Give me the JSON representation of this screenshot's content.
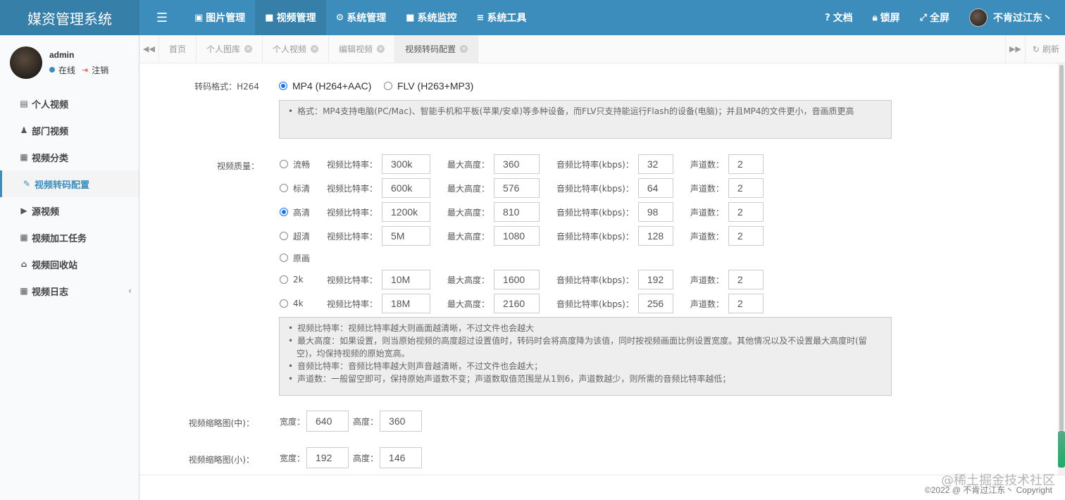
{
  "app": {
    "title": "媒资管理系统"
  },
  "topnav": {
    "items": [
      {
        "label": "图片管理",
        "icon": "image-icon"
      },
      {
        "label": "视频管理",
        "icon": "video-icon",
        "active": true
      },
      {
        "label": "系统管理",
        "icon": "gear-icon"
      },
      {
        "label": "系统监控",
        "icon": "monitor-icon"
      },
      {
        "label": "系统工具",
        "icon": "bars-icon"
      }
    ],
    "right": {
      "docs": "文档",
      "lock": "锁屏",
      "fullscreen": "全屏",
      "user": "不肯过江东丶"
    }
  },
  "sidebar": {
    "user": {
      "name": "admin",
      "status": "在线",
      "logout": "注销"
    },
    "items": [
      {
        "label": "个人视频",
        "icon": "file-icon"
      },
      {
        "label": "部门视频",
        "icon": "users-icon"
      },
      {
        "label": "视频分类",
        "icon": "calendar-icon"
      },
      {
        "label": "视频转码配置",
        "icon": "wrench-icon",
        "active": true
      },
      {
        "label": "源视频",
        "icon": "play-square-icon"
      },
      {
        "label": "视频加工任务",
        "icon": "calendar-icon"
      },
      {
        "label": "视频回收站",
        "icon": "basket-icon"
      },
      {
        "label": "视频日志",
        "icon": "calendar-icon"
      }
    ]
  },
  "tabs": {
    "items": [
      {
        "label": "首页",
        "closable": false
      },
      {
        "label": "个人图库",
        "closable": true
      },
      {
        "label": "个人视频",
        "closable": true
      },
      {
        "label": "编辑视频",
        "closable": true
      },
      {
        "label": "视频转码配置",
        "closable": true,
        "active": true
      }
    ],
    "refresh": "刷新"
  },
  "form": {
    "format_label": "转码格式：H264",
    "format_options": [
      {
        "label": "MP4 (H264+AAC)",
        "checked": true
      },
      {
        "label": "FLV (H263+MP3)",
        "checked": false
      }
    ],
    "format_hint": "格式：MP4支持电脑(PC/Mac)、智能手机和平板(苹果/安卓)等多种设备，而FLV只支持能运行Flash的设备(电脑)；并且MP4的文件更小，音画质更高",
    "quality_label": "视频质量：",
    "field_labels": {
      "vbitrate": "视频比特率：",
      "maxheight": "最大高度：",
      "abitrate": "音频比特率(kbps)：",
      "channels": "声道数："
    },
    "qualities": [
      {
        "name": "流畅",
        "checked": false,
        "vbitrate": "300k",
        "maxheight": "360",
        "abitrate": "32",
        "channels": "2"
      },
      {
        "name": "标清",
        "checked": false,
        "vbitrate": "600k",
        "maxheight": "576",
        "abitrate": "64",
        "channels": "2"
      },
      {
        "name": "高清",
        "checked": true,
        "vbitrate": "1200k",
        "maxheight": "810",
        "abitrate": "98",
        "channels": "2"
      },
      {
        "name": "超清",
        "checked": false,
        "vbitrate": "5M",
        "maxheight": "1080",
        "abitrate": "128",
        "channels": "2"
      },
      {
        "name": "原画",
        "checked": false
      },
      {
        "name": "2k",
        "checked": false,
        "vbitrate": "10M",
        "maxheight": "1600",
        "abitrate": "192",
        "channels": "2"
      },
      {
        "name": "4k",
        "checked": false,
        "vbitrate": "18M",
        "maxheight": "2160",
        "abitrate": "256",
        "channels": "2"
      }
    ],
    "quality_hints": [
      "视频比特率：视频比特率越大则画面越清晰，不过文件也会越大",
      "最大高度：如果设置，则当原始视频的高度超过设置值时，转码时会将高度降为该值，同时按视频画面比例设置宽度。其他情况以及不设置最大高度时(留空)，均保持视频的原始宽高。",
      "音频比特率：音频比特率越大则声音越清晰，不过文件也会越大；",
      "声道数：一般留空即可，保持原始声道数不变；声道数取值范围是从1到6，声道数越少，则所需的音频比特率越低；"
    ],
    "thumb_mid": {
      "label": "视频缩略图(中)：",
      "width_label": "宽度：",
      "width": "640",
      "height_label": "高度：",
      "height": "360"
    },
    "thumb_small": {
      "label": "视频缩略图(小)：",
      "width_label": "宽度：",
      "width": "192",
      "height_label": "高度：",
      "height": "146"
    }
  },
  "footer": {
    "copyright": "©2022 @ 不肯过江东丶 Copyright"
  },
  "watermark": "@稀土掘金技术社区",
  "colors": {
    "primary": "#3c8dbc",
    "primary_dark": "#367fa9",
    "radio_checked": "#1a73e8"
  }
}
